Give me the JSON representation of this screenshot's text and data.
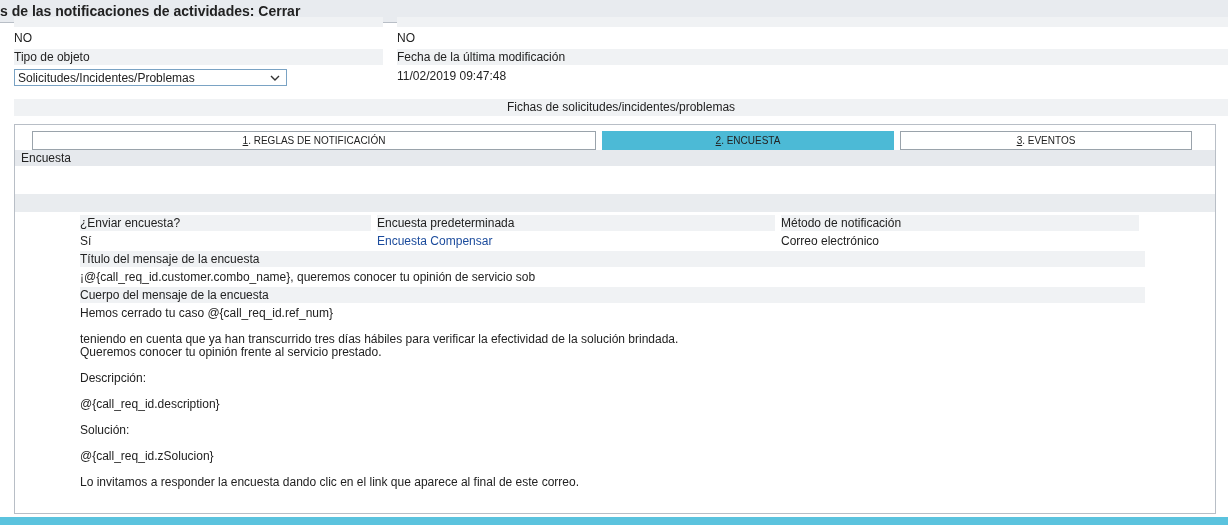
{
  "window": {
    "title": "s de las notificaciones de actividades: Cerrar"
  },
  "header_fields": [
    {
      "value": "NO",
      "kind": "text"
    },
    {
      "value": "NO",
      "kind": "text"
    },
    {
      "label": "Tipo de objeto",
      "value": "Solicitudes/Incidentes/Problemas",
      "kind": "select"
    },
    {
      "label": "Fecha de la última modificación",
      "value": "11/02/2019 09:47:48",
      "kind": "text"
    }
  ],
  "section_title": "Fichas de solicitudes/incidentes/problemas",
  "tabs": [
    {
      "key": "1",
      "label": ". REGLAS DE NOTIFICACIÓN",
      "selected": false
    },
    {
      "key": "2",
      "label": ". ENCUESTA",
      "selected": true
    },
    {
      "key": "3",
      "label": ". EVENTOS",
      "selected": false
    }
  ],
  "tab_heading": "Encuesta",
  "survey_fields": [
    {
      "label": "¿Enviar encuesta?",
      "value": "Sí",
      "kind": "text"
    },
    {
      "label": "Encuesta predeterminada",
      "value": "Encuesta Compensar",
      "kind": "link"
    },
    {
      "label": "Método de notificación",
      "value": "Correo electrónico",
      "kind": "text"
    }
  ],
  "message_title": {
    "label": "Título del mensaje de la encuesta",
    "value": "¡@{call_req_id.customer.combo_name}, queremos conocer tu opinión de servicio sob"
  },
  "message_body": {
    "label": "Cuerpo del mensaje de la encuesta",
    "paragraphs": [
      [
        "Hemos cerrado tu caso @{call_req_id.ref_num}"
      ],
      [
        "teniendo en cuenta que ya han transcurrido tres días hábiles para verificar la efectividad de la solución brindada.",
        "Queremos conocer tu opinión frente al servicio prestado."
      ],
      [
        "Descripción:"
      ],
      [
        "@{call_req_id.description}"
      ],
      [
        "Solución:"
      ],
      [
        "@{call_req_id.zSolucion}"
      ],
      [
        "Lo invitamos a responder la encuesta dando clic en el link que aparece al final de este correo."
      ]
    ]
  }
}
